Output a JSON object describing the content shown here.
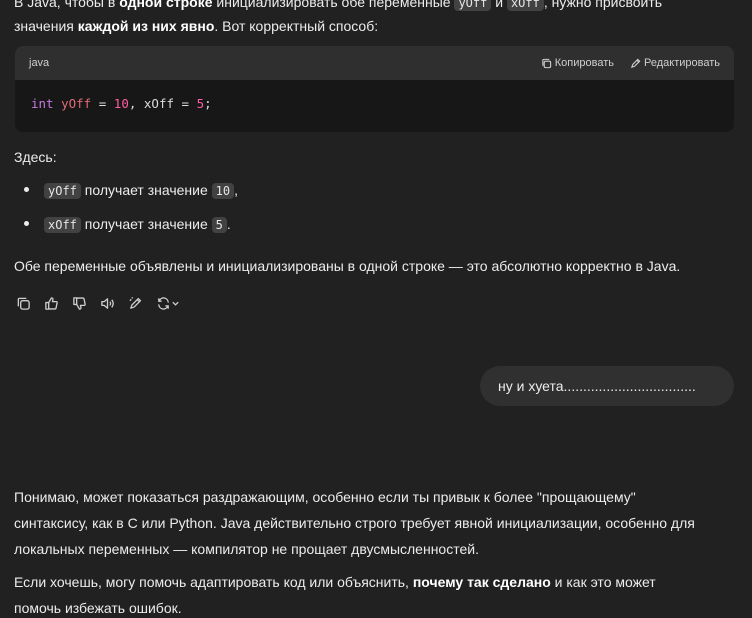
{
  "intro": {
    "part1": "В Java, чтобы в ",
    "bold1": "одной строке",
    "part2": " инициализировать обе переменные ",
    "code1": "yOff",
    "part3": " и ",
    "code2": "xOff",
    "part4": ", нужно присвоить",
    "line2_part1": "значения ",
    "line2_bold": "каждой из них явно",
    "line2_part2": ". Вот корректный способ:"
  },
  "code_block": {
    "language": "java",
    "copy_label": "Копировать",
    "edit_label": "Редактировать",
    "tokens": {
      "kw": "int",
      "var1": "yOff",
      "eq1": " = ",
      "num1": "10",
      "sep": ", xOff = ",
      "num2": "5",
      "end": ";"
    }
  },
  "here_label": "Здесь:",
  "bullets": [
    {
      "code": "yOff",
      "text": " получает значение ",
      "value": "10",
      "end": ","
    },
    {
      "code": "xOff",
      "text": " получает значение ",
      "value": "5",
      "end": "."
    }
  ],
  "summary": "Обе переменные объявлены и инициализированы в одной строке — это абсолютно корректно в Java.",
  "actions": [
    "copy-icon",
    "thumbs-up-icon",
    "thumbs-down-icon",
    "read-aloud-icon",
    "edit-icon",
    "regenerate-icon"
  ],
  "user_message": "ну и хуета..................................",
  "reply": {
    "p1_line1": "Понимаю, может показаться раздражающим, особенно если ты привык к более \"прощающему\"",
    "p1_line2": "синтаксису, как в C или Python. Java действительно строго требует явной инициализации, особенно для",
    "p1_line3": "локальных переменных — компилятор не прощает двусмысленностей.",
    "p2_part1": "Если хочешь, могу помочь адаптировать код или объяснить, ",
    "p2_bold": "почему так сделано",
    "p2_part2": " и как это может",
    "p2_line2": "помочь избежать ошибок."
  },
  "colors": {
    "background": "#212121",
    "code_background": "#171717",
    "code_header": "#2f2f2f",
    "bubble": "#303030",
    "number": "#ff5fa2"
  }
}
